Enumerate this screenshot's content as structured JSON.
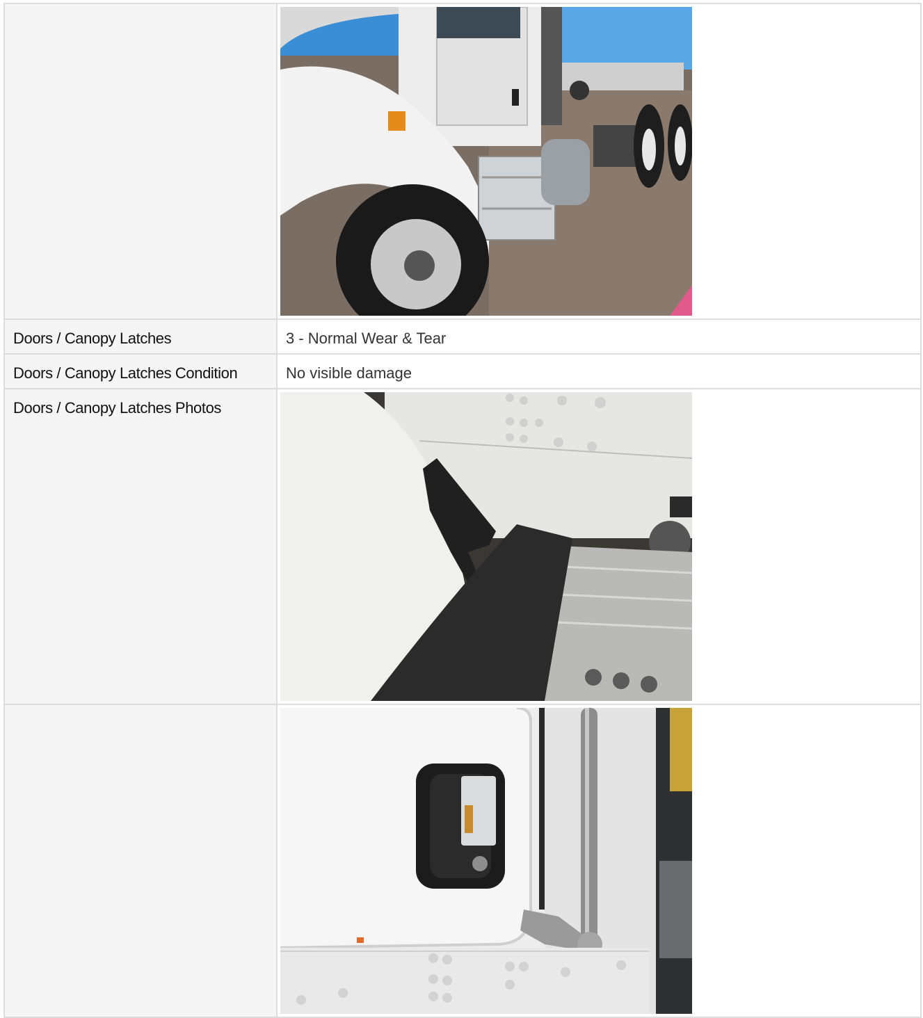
{
  "rows": [
    {
      "label": "",
      "type": "photo",
      "photo_icon": "truck-exterior-photo"
    },
    {
      "label": "Doors / Canopy Latches",
      "type": "text",
      "value": "3 - Normal Wear & Tear"
    },
    {
      "label": "Doors / Canopy Latches Condition",
      "type": "text",
      "value": "No visible damage"
    },
    {
      "label": "Doors / Canopy Latches Photos",
      "type": "photo",
      "photo_icon": "hood-latch-photo"
    },
    {
      "label": "",
      "type": "photo",
      "photo_icon": "door-handle-photo"
    }
  ]
}
